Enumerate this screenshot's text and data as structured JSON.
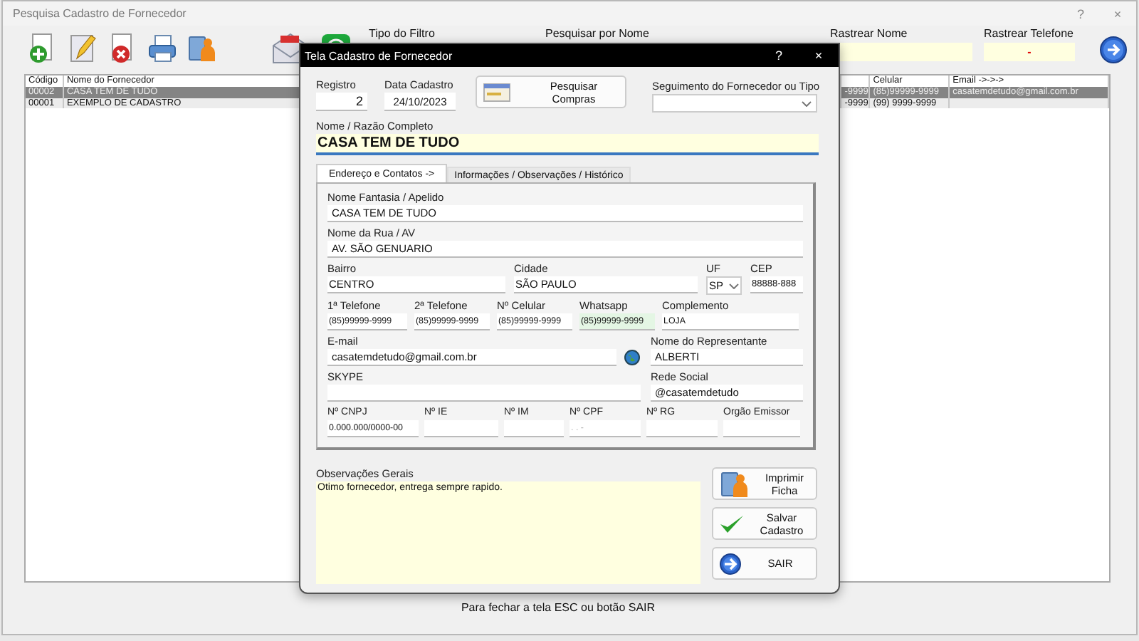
{
  "window": {
    "title": "Pesquisa Cadastro de Fornecedor",
    "help": "?",
    "close": "×"
  },
  "filters": [
    {
      "label": "Tipo do Filtro",
      "kind": "label"
    },
    {
      "label": "Pesquisar por Nome",
      "kind": "label"
    },
    {
      "label": "Rastrear Nome",
      "kind": "field"
    },
    {
      "label": "Rastrear Telefone",
      "kind": "field",
      "value": "-"
    }
  ],
  "table": {
    "columns": [
      "Código",
      "Nome do Fornecedor",
      "Celular",
      "Email ->->->"
    ],
    "rows": [
      {
        "codigo": "00002",
        "nome": "CASA TEM DE TUDO",
        "column_3": "-9999",
        "celular": "(85)99999-9999",
        "email": "casatemdetudo@gmail.com.br",
        "selected": true
      },
      {
        "codigo": "00001",
        "nome": "EXEMPLO DE CADASTRO",
        "column_3": "-9999",
        "celular": "(99) 9999-9999",
        "selected": false
      }
    ]
  },
  "dialog": {
    "title": "Tela Cadastro de Fornecedor",
    "help": "?",
    "close": "×",
    "registro": {
      "label": "Registro",
      "value": "2"
    },
    "data_cadastro": {
      "label": "Data Cadastro",
      "value": "24/10/2023"
    },
    "search_button": "Pesquisar Compras",
    "segmento": {
      "label": "Seguimento do Fornecedor ou Tipo"
    },
    "nome": {
      "label": "Nome / Razão Completo",
      "value": "CASA TEM DE TUDO"
    },
    "tabs": [
      {
        "label": "Endereço e Contatos ->",
        "selected": true
      },
      {
        "label": "Informações / Observações / Histórico",
        "selected": false
      }
    ],
    "rows": [
      {
        "fields": [
          {
            "label": "Nome Fantasia / Apelido",
            "value": "CASA TEM DE TUDO",
            "kind": "text"
          }
        ]
      },
      {
        "fields": [
          {
            "label": "Nome da Rua / AV",
            "value": "AV. SÃO GENUARIO",
            "kind": "text"
          }
        ]
      },
      {
        "fields": [
          {
            "label": "Bairro",
            "value": "CENTRO",
            "kind": "text"
          },
          {
            "label": "Cidade",
            "value": "SÃO PAULO",
            "kind": "text"
          },
          {
            "label": "UF",
            "value": "SP",
            "kind": "select"
          },
          {
            "label": "CEP",
            "value": "88888-888",
            "kind": "text"
          }
        ]
      },
      {
        "fields": [
          {
            "label": "1ª Telefone",
            "value": "(85)99999-9999",
            "kind": "text"
          },
          {
            "label": "2ª Telefone",
            "value": "(85)99999-9999",
            "kind": "text"
          },
          {
            "label": "Nº Celular",
            "value": "(85)99999-9999",
            "kind": "text"
          },
          {
            "label": "Whatsapp",
            "value": "(85)99999-9999",
            "kind": "tinted"
          },
          {
            "label": "Complemento",
            "value": "LOJA",
            "kind": "text"
          }
        ]
      },
      {
        "fields": [
          {
            "label": "E-mail",
            "value": "casatemdetudo@gmail.com.br",
            "kind": "email"
          },
          {
            "label": "Nome do Representante",
            "value": "ALBERTI",
            "kind": "text"
          }
        ]
      },
      {
        "fields": [
          {
            "label": "SKYPE",
            "kind": "text"
          },
          {
            "label": "Rede Social",
            "value": "@casatemdetudo",
            "kind": "text"
          }
        ]
      },
      {
        "fields": [
          {
            "label": "Nº CNPJ",
            "value": "0.000.000/0000-00",
            "kind": "text"
          },
          {
            "label": "Nº IE",
            "kind": "text"
          },
          {
            "label": "Nº IM",
            "kind": "text"
          },
          {
            "label": "Nº CPF",
            "placeholder": ". . -",
            "kind": "text"
          },
          {
            "label": "Nº RG",
            "kind": "text"
          },
          {
            "label": "Orgão Emissor",
            "kind": "text"
          }
        ]
      }
    ],
    "observacoes": {
      "label": "Observações Gerais",
      "value": "Otimo fornecedor, entrega sempre rapido."
    },
    "buttons": [
      "Imprimir Ficha",
      "Salvar Cadastro",
      "SAIR"
    ]
  },
  "footer_hint": "Para fechar a tela ESC ou botão SAIR"
}
